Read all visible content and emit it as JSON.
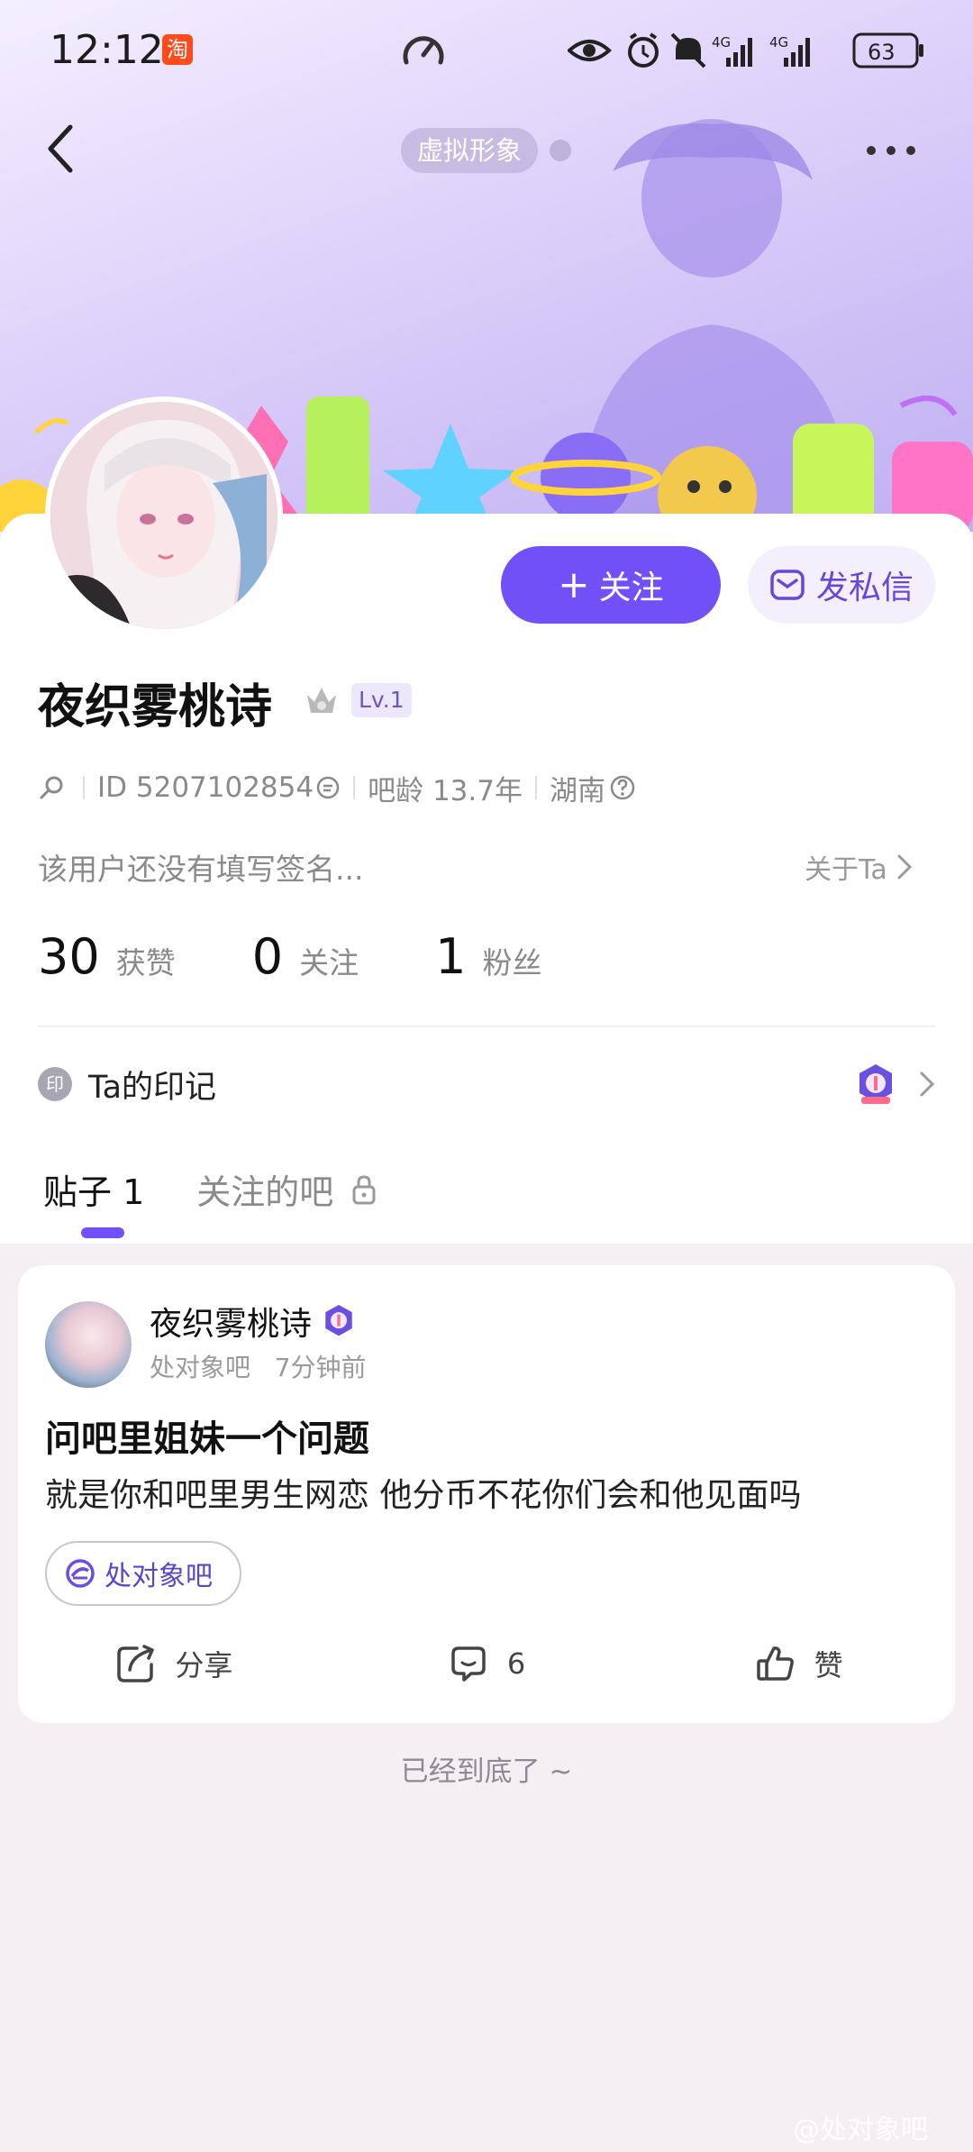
{
  "status_bar": {
    "time": "12:12",
    "taobao_badge": "淘",
    "battery": "63",
    "network_1": "4G",
    "network_2": "4G"
  },
  "header": {
    "avatar_pill": "虚拟形象"
  },
  "profile": {
    "username": "夜织雾桃诗",
    "level": "Lv.1",
    "id_label": "ID 5207102854",
    "age_label": "吧龄 13.7年",
    "location": "湖南",
    "signature": "该用户还没有填写签名...",
    "about_label": "关于Ta",
    "follow_label": "关注",
    "message_label": "发私信",
    "stats": [
      {
        "value": "30",
        "label": "获赞"
      },
      {
        "value": "0",
        "label": "关注"
      },
      {
        "value": "1",
        "label": "粉丝"
      }
    ],
    "mark_icon_text": "印",
    "mark_label": "Ta的印记"
  },
  "tabs": {
    "posts": "贴子 1",
    "followed_bars": "关注的吧"
  },
  "post": {
    "author": "夜织雾桃诗",
    "forum": "处对象吧",
    "time": "7分钟前",
    "title": "问吧里姐妹一个问题",
    "body": "就是你和吧里男生网恋 他分币不花你们会和他见面吗",
    "tag": "处对象吧",
    "share_label": "分享",
    "comment_count": "6",
    "like_label": "赞"
  },
  "footer": {
    "end_text": "已经到底了 ~",
    "watermark": "@处对象吧"
  },
  "colors": {
    "accent": "#7150f7",
    "banner_light": "#f4efff",
    "banner_dark": "#bfb0f2"
  }
}
